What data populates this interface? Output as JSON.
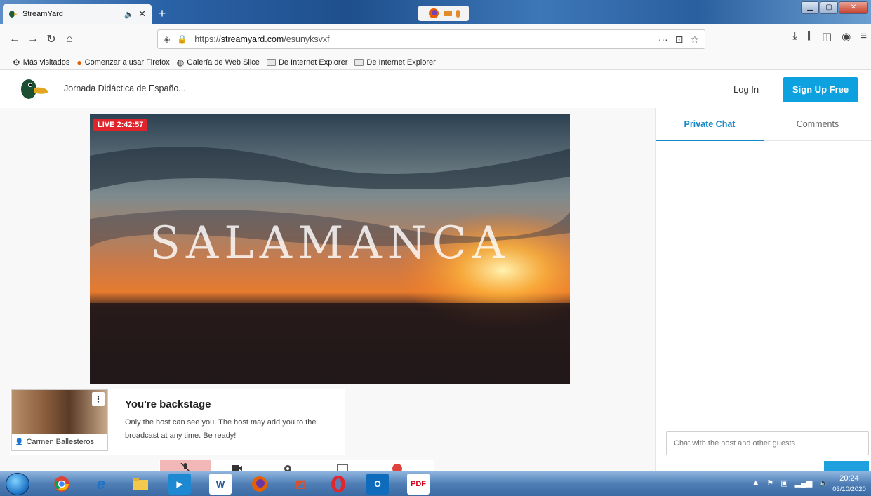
{
  "browser": {
    "tab_title": "StreamYard",
    "new_tab_label": "+",
    "url_prefix": "https://",
    "url_domain": "streamyard.com",
    "url_path": "/esunyksvxf",
    "urlbar_more": "···"
  },
  "bookmarks": [
    {
      "label": "Más visitados",
      "icon": "gear-icon"
    },
    {
      "label": "Comenzar a usar Firefox",
      "icon": "firefox-icon"
    },
    {
      "label": "Galería de Web Slice",
      "icon": "globe-icon"
    },
    {
      "label": "De Internet Explorer",
      "icon": "folder-icon"
    },
    {
      "label": "De Internet Explorer",
      "icon": "folder-icon"
    }
  ],
  "header": {
    "broadcast_title": "Jornada Didáctica de Españo...",
    "login_label": "Log In",
    "signup_label": "Sign Up Free"
  },
  "stream": {
    "live_badge": "LIVE 2:42:57",
    "video_title_art": "SALAMANCA"
  },
  "backstage": {
    "participant_name": "Carmen Ballesteros",
    "heading": "You're backstage",
    "message": "Only the host can see you. The host may add you to the broadcast at any time. Be ready!"
  },
  "chat": {
    "tab_private": "Private Chat",
    "tab_comments": "Comments",
    "input_placeholder": "Chat with the host and other guests"
  },
  "taskbar": {
    "time": "20:24",
    "date": "03/10/2020"
  },
  "colors": {
    "brand_blue": "#0ea1e0",
    "live_red": "#e0242c",
    "tab_active": "#1687c8"
  }
}
